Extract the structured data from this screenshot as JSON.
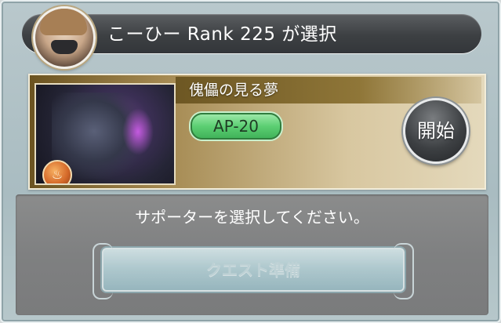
{
  "header": {
    "text": "こーひー Rank 225 が選択",
    "avatar_icon": "character-portrait"
  },
  "quest": {
    "title": "傀儡の見る夢",
    "ap_cost": "AP-20",
    "element_icon": "fire-element-icon",
    "start_label": "開始"
  },
  "support": {
    "instruction": "サポーターを選択してください。",
    "prepare_label": "クエスト準備"
  },
  "colors": {
    "header_bg": "#3d4043",
    "ap_badge_green": "#5ccf73",
    "card_gold": "#a58a52",
    "panel_gray": "#7f8081"
  }
}
